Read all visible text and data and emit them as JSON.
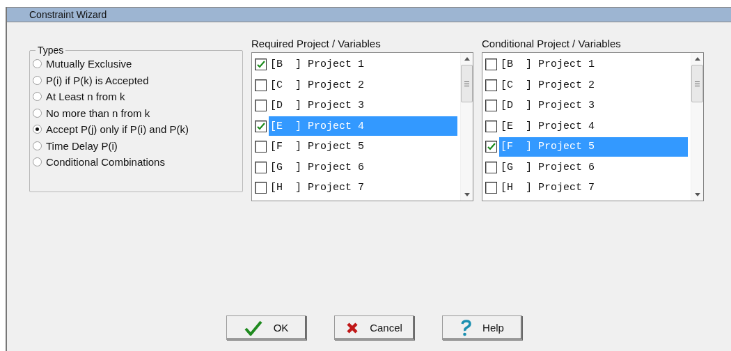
{
  "window": {
    "title": "Constraint Wizard"
  },
  "types": {
    "legend": "Types",
    "options": [
      {
        "label": "Mutually Exclusive",
        "selected": false
      },
      {
        "label": "P(i) if P(k) is Accepted",
        "selected": false
      },
      {
        "label": "At Least n from k",
        "selected": false
      },
      {
        "label": "No more than n from k",
        "selected": false
      },
      {
        "label": "Accept P(j) only if P(i) and P(k)",
        "selected": true
      },
      {
        "label": "Time Delay P(i)",
        "selected": false
      },
      {
        "label": "Conditional Combinations",
        "selected": false
      }
    ]
  },
  "lists": [
    {
      "title": "Required Project / Variables",
      "items": [
        {
          "label": "[B  ] Project 1",
          "checked": true,
          "selected": false
        },
        {
          "label": "[C  ] Project 2",
          "checked": false,
          "selected": false
        },
        {
          "label": "[D  ] Project 3",
          "checked": false,
          "selected": false
        },
        {
          "label": "[E  ] Project 4",
          "checked": true,
          "selected": true
        },
        {
          "label": "[F  ] Project 5",
          "checked": false,
          "selected": false
        },
        {
          "label": "[G  ] Project 6",
          "checked": false,
          "selected": false
        },
        {
          "label": "[H  ] Project 7",
          "checked": false,
          "selected": false
        }
      ]
    },
    {
      "title": "Conditional Project / Variables",
      "items": [
        {
          "label": "[B  ] Project 1",
          "checked": false,
          "selected": false
        },
        {
          "label": "[C  ] Project 2",
          "checked": false,
          "selected": false
        },
        {
          "label": "[D  ] Project 3",
          "checked": false,
          "selected": false
        },
        {
          "label": "[E  ] Project 4",
          "checked": false,
          "selected": false
        },
        {
          "label": "[F  ] Project 5",
          "checked": true,
          "selected": true
        },
        {
          "label": "[G  ] Project 6",
          "checked": false,
          "selected": false
        },
        {
          "label": "[H  ] Project 7",
          "checked": false,
          "selected": false
        }
      ]
    }
  ],
  "buttons": [
    {
      "kind": "ok",
      "label": "OK"
    },
    {
      "kind": "cancel",
      "label": "Cancel"
    },
    {
      "kind": "help",
      "label": "Help"
    }
  ]
}
